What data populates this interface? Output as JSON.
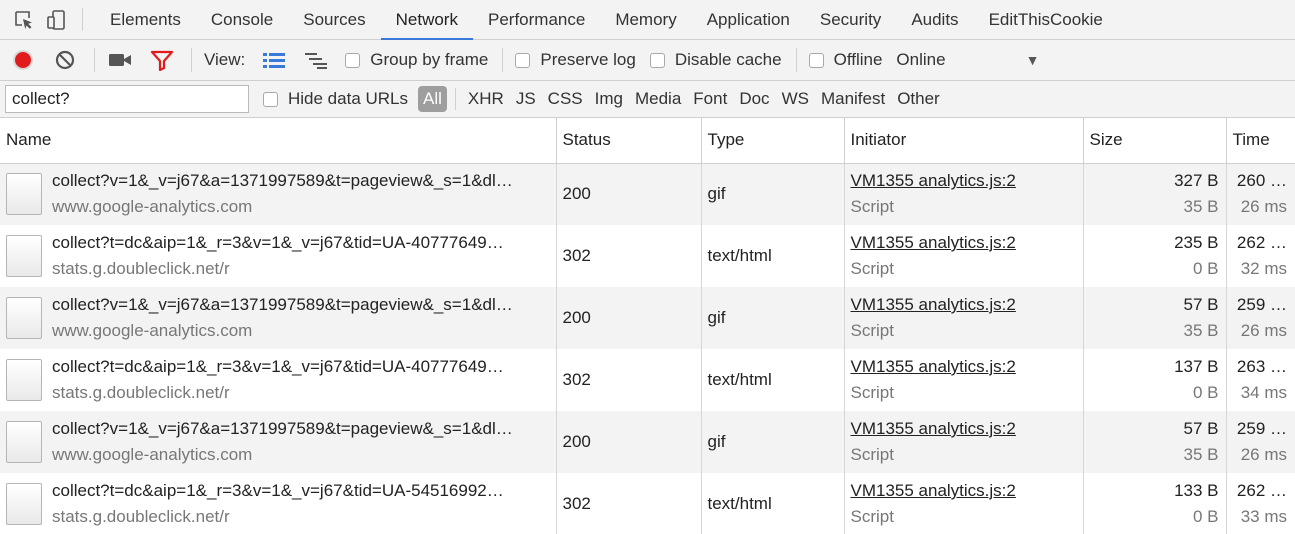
{
  "tabs": [
    "Elements",
    "Console",
    "Sources",
    "Network",
    "Performance",
    "Memory",
    "Application",
    "Security",
    "Audits",
    "EditThisCookie"
  ],
  "active_tab": "Network",
  "toolbar": {
    "view_label": "View:",
    "group_by_frame": "Group by frame",
    "preserve_log": "Preserve log",
    "disable_cache": "Disable cache",
    "offline": "Offline",
    "throttle": "Online",
    "record_color": "#e11b1b",
    "filter_icon_color": "#e11b1b",
    "view_icon_color": "#3879d9"
  },
  "filter": {
    "value": "collect?",
    "hide_data_urls": "Hide data URLs",
    "types": [
      "All",
      "XHR",
      "JS",
      "CSS",
      "Img",
      "Media",
      "Font",
      "Doc",
      "WS",
      "Manifest",
      "Other"
    ],
    "active_type": "All"
  },
  "columns": {
    "name": "Name",
    "status": "Status",
    "type": "Type",
    "initiator": "Initiator",
    "size": "Size",
    "time": "Time"
  },
  "rows": [
    {
      "name": "collect?v=1&_v=j67&a=1371997589&t=pageview&_s=1&dl…",
      "domain": "www.google-analytics.com",
      "status": "200",
      "type": "gif",
      "initiator": "VM1355 analytics.js:2",
      "initiator_type": "Script",
      "size": "327 B",
      "content": "35 B",
      "time": "260 …",
      "latency": "26 ms"
    },
    {
      "name": "collect?t=dc&aip=1&_r=3&v=1&_v=j67&tid=UA-40777649…",
      "domain": "stats.g.doubleclick.net/r",
      "status": "302",
      "type": "text/html",
      "initiator": "VM1355 analytics.js:2",
      "initiator_type": "Script",
      "size": "235 B",
      "content": "0 B",
      "time": "262 …",
      "latency": "32 ms"
    },
    {
      "name": "collect?v=1&_v=j67&a=1371997589&t=pageview&_s=1&dl…",
      "domain": "www.google-analytics.com",
      "status": "200",
      "type": "gif",
      "initiator": "VM1355 analytics.js:2",
      "initiator_type": "Script",
      "size": "57 B",
      "content": "35 B",
      "time": "259 …",
      "latency": "26 ms"
    },
    {
      "name": "collect?t=dc&aip=1&_r=3&v=1&_v=j67&tid=UA-40777649…",
      "domain": "stats.g.doubleclick.net/r",
      "status": "302",
      "type": "text/html",
      "initiator": "VM1355 analytics.js:2",
      "initiator_type": "Script",
      "size": "137 B",
      "content": "0 B",
      "time": "263 …",
      "latency": "34 ms"
    },
    {
      "name": "collect?v=1&_v=j67&a=1371997589&t=pageview&_s=1&dl…",
      "domain": "www.google-analytics.com",
      "status": "200",
      "type": "gif",
      "initiator": "VM1355 analytics.js:2",
      "initiator_type": "Script",
      "size": "57 B",
      "content": "35 B",
      "time": "259 …",
      "latency": "26 ms"
    },
    {
      "name": "collect?t=dc&aip=1&_r=3&v=1&_v=j67&tid=UA-54516992…",
      "domain": "stats.g.doubleclick.net/r",
      "status": "302",
      "type": "text/html",
      "initiator": "VM1355 analytics.js:2",
      "initiator_type": "Script",
      "size": "133 B",
      "content": "0 B",
      "time": "262 …",
      "latency": "33 ms"
    }
  ]
}
